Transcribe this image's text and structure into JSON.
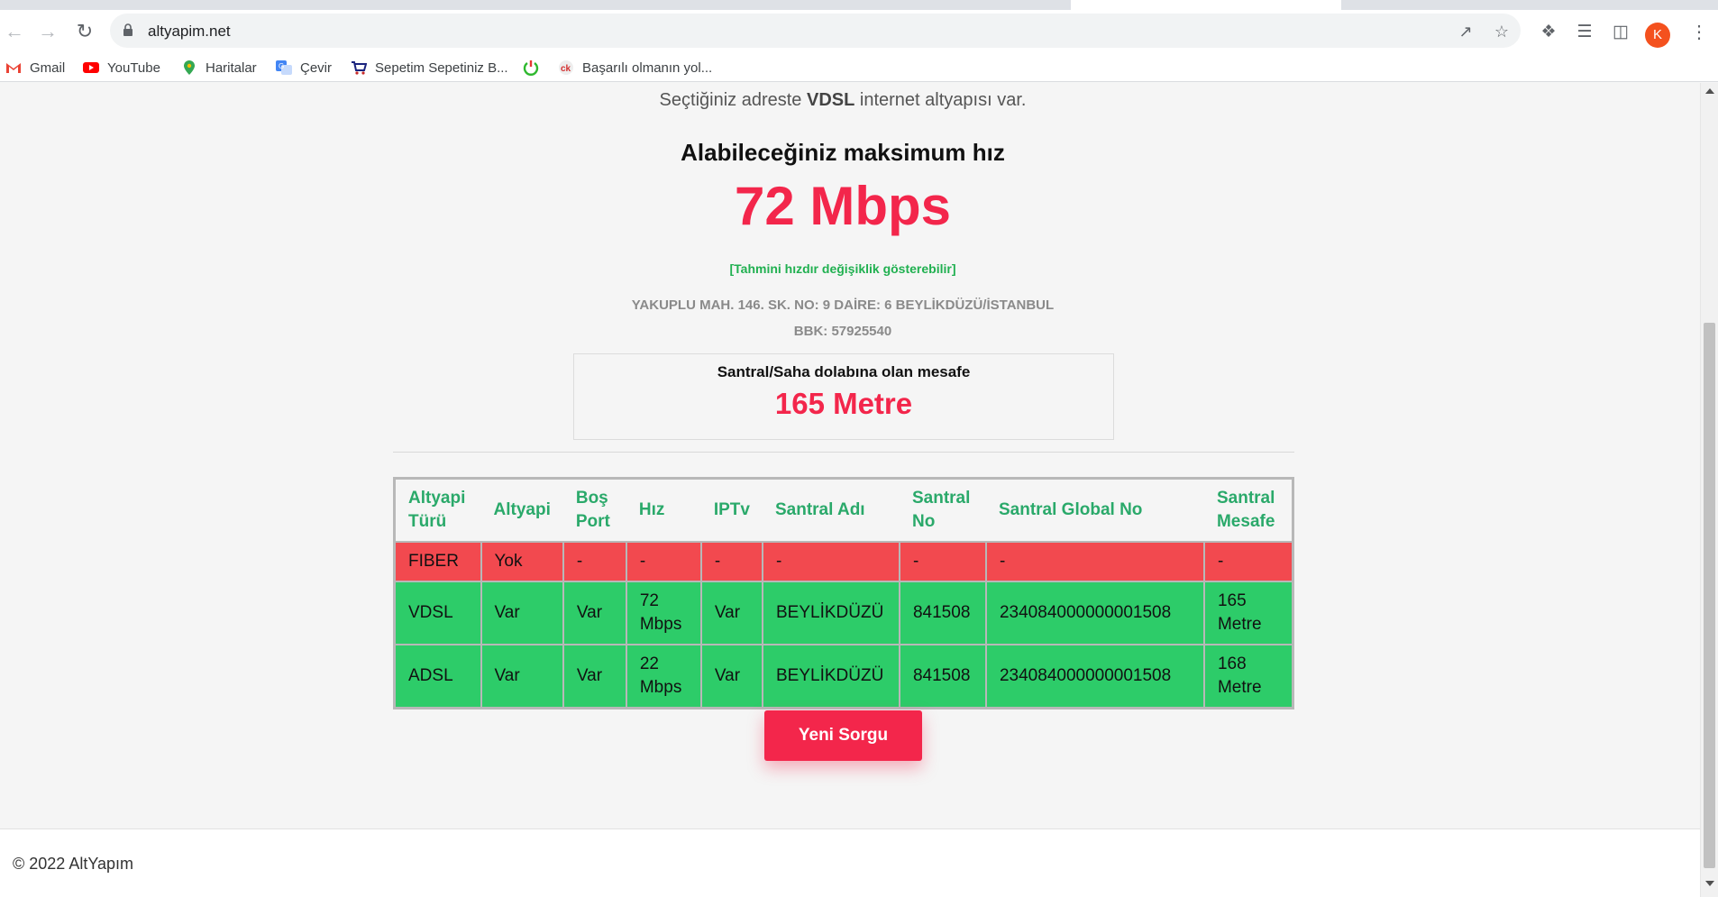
{
  "browser": {
    "url": "altyapim.net",
    "avatar_letter": "K",
    "bookmarks": [
      {
        "label": "Gmail",
        "icon": "gmail-icon"
      },
      {
        "label": "YouTube",
        "icon": "youtube-icon"
      },
      {
        "label": "Haritalar",
        "icon": "maps-icon"
      },
      {
        "label": "Çevir",
        "icon": "translate-icon"
      },
      {
        "label": "Sepetim Sepetiniz B...",
        "icon": "cart-icon"
      },
      {
        "label": "",
        "icon": "power-icon"
      },
      {
        "label": "Başarılı olmanın yol...",
        "icon": "site-icon"
      }
    ]
  },
  "result": {
    "summary_prefix": "Seçtiğiniz adreste",
    "summary_bold": "VDSL",
    "summary_suffix": "internet altyapısı var.",
    "max_heading": "Alabileceğiniz maksimum hız",
    "max_speed": "72 Mbps",
    "note": "[Tahmini hızdır değişiklik gösterebilir]",
    "address": "YAKUPLU MAH. 146. SK. NO: 9 DAİRE: 6 BEYLİKDÜZÜ/İSTANBUL",
    "bbk": "BBK: 57925540",
    "distance_title": "Santral/Saha dolabına olan mesafe",
    "distance_value": "165 Metre"
  },
  "table": {
    "headers": [
      "Altyapi Türü",
      "Altyapi",
      "Boş Port",
      "Hız",
      "IPTv",
      "Santral Adı",
      "Santral No",
      "Santral Global No",
      "Santral Mesafe"
    ],
    "rows": [
      [
        "FIBER",
        "Yok",
        "-",
        "-",
        "-",
        "-",
        "-",
        "-",
        "-"
      ],
      [
        "VDSL",
        "Var",
        "Var",
        "72 Mbps",
        "Var",
        "BEYLİKDÜZÜ",
        "841508",
        "234084000000001508",
        "165 Metre"
      ],
      [
        "ADSL",
        "Var",
        "Var",
        "22 Mbps",
        "Var",
        "BEYLİKDÜZÜ",
        "841508",
        "234084000000001508",
        "168 Metre"
      ]
    ]
  },
  "actions": {
    "new_query_label": "Yeni Sorgu"
  },
  "footer": {
    "text": "© 2022 AltYapım"
  },
  "colors": {
    "accent_red": "#f3264b",
    "row_red": "#f2494f",
    "row_green": "#2dcc69",
    "header_green": "#2aa96a",
    "note_green": "#20b050"
  }
}
